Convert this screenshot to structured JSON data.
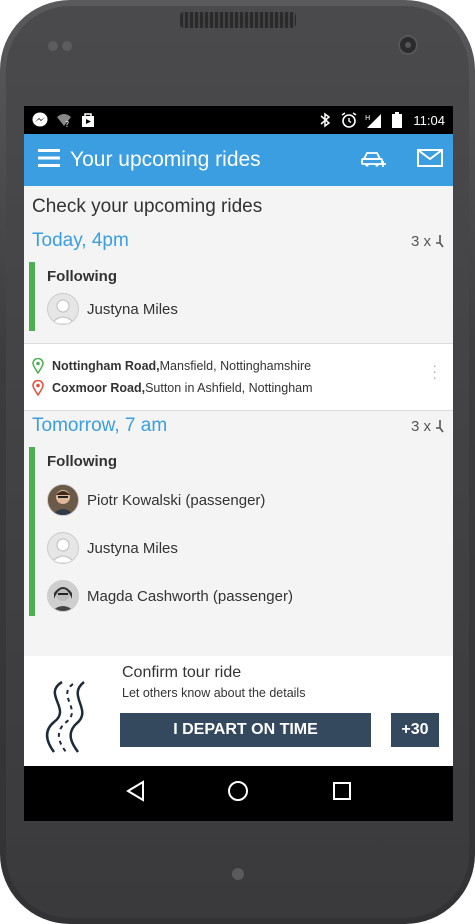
{
  "status_bar": {
    "time": "11:04"
  },
  "app_bar": {
    "title": "Your upcoming rides"
  },
  "heading": "Check your upcoming rides",
  "rides": [
    {
      "day": "Today, 4pm",
      "count": "3 x",
      "group_label": "Following",
      "people": [
        "Justyna Miles"
      ]
    },
    {
      "day": "Tomorrow, 7 am",
      "count": "3 x",
      "group_label": "Following",
      "people": [
        "Piotr Kowalski (passenger)",
        "Justyna Miles",
        "Magda Cashworth (passenger)"
      ]
    }
  ],
  "route": {
    "from_bold": "Nottingham Road,",
    "from_rest": " Mansfield, Nottinghamshire",
    "to_bold": "Coxmoor Road,",
    "to_rest": " Sutton in Ashfield, Nottingham"
  },
  "confirm": {
    "title": "Confirm tour ride",
    "subtitle": "Let others know about the details",
    "depart_label": "I DEPART ON TIME",
    "plus_label": "+30"
  },
  "colors": {
    "accent": "#3a9ee0",
    "green": "#4caf50",
    "button": "#34495e"
  }
}
